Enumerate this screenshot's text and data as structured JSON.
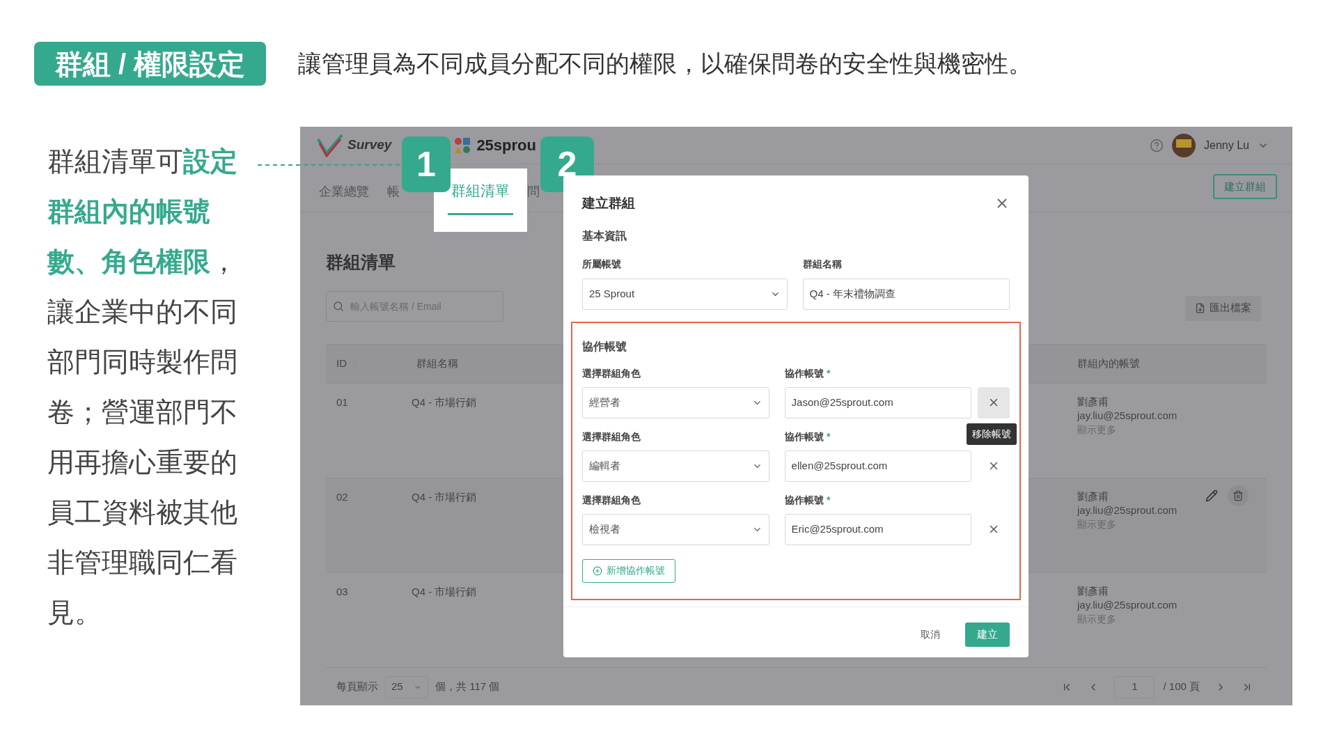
{
  "headline": {
    "badge": "群組 / 權限設定",
    "text": "讓管理員為不同成員分配不同的權限，以確保問卷的安全性與機密性。"
  },
  "description": "群組清單可**設定群組內的帳號數、角色權限**，讓企業中的不同部門同時製作問卷；營運部門不用再擔心重要的員工資料被其他非管理職同仁看見。",
  "callouts": [
    "1",
    "2"
  ],
  "app": {
    "logo_text": "Survey",
    "brand_text": "25sprou",
    "user": "Jenny Lu",
    "nav": [
      {
        "label": "企業總覽",
        "selected": false
      },
      {
        "label": "帳",
        "selected": false
      },
      {
        "label": "群組清單",
        "selected": true
      },
      {
        "label": "問",
        "selected": false
      }
    ],
    "create_button": "建立群組",
    "page_title": "群組清單",
    "search": {
      "placeholder": "輸入帳號名稱 / Email"
    },
    "export_button": "匯出檔案",
    "table": {
      "columns": [
        "ID",
        "群組名稱",
        "群組內的帳號"
      ],
      "rows": [
        {
          "id": "01",
          "name": "Q4 - 市場行銷",
          "member_name": "劉彥甫",
          "member_email": "jay.liu@25sprout.com",
          "more": "顯示更多",
          "hovered": false
        },
        {
          "id": "02",
          "name": "Q4 - 市場行銷",
          "member_name": "劉彥甫",
          "member_email": "jay.liu@25sprout.com",
          "more": "顯示更多",
          "hovered": true
        },
        {
          "id": "03",
          "name": "Q4 - 市場行銷",
          "member_name": "劉彥甫",
          "member_email": "jay.liu@25sprout.com",
          "more": "顯示更多",
          "hovered": false
        }
      ]
    },
    "pagination": {
      "per_page_label": "每頁顯示",
      "per_page": "25",
      "total": "個，共 117 個",
      "page": "1",
      "pages": "/ 100 頁"
    }
  },
  "dialog": {
    "title": "建立群組",
    "section": "基本資訊",
    "account_label": "所屬帳號",
    "account": "25 Sprout",
    "group_name_label": "群組名稱",
    "group_name": "Q4 - 年末禮物調查",
    "collab_title": "協作帳號",
    "members": [
      {
        "role_label": "選擇群組角色",
        "role": "經營者",
        "account_label": "協作帳號",
        "required_mark": "*",
        "account": "Jason@25sprout.com",
        "hovered": true
      },
      {
        "role_label": "選擇群組角色",
        "role": "編輯者",
        "account_label": "協作帳號",
        "required_mark": "*",
        "account": "ellen@25sprout.com",
        "hovered": false
      },
      {
        "role_label": "選擇群組角色",
        "role": "檢視者",
        "account_label": "協作帳號",
        "required_mark": "*",
        "account": "Eric@25sprout.com",
        "hovered": false
      }
    ],
    "tooltip": "移除帳號",
    "add_button": "新增協作帳號",
    "cancel": "取消",
    "submit": "建立"
  }
}
